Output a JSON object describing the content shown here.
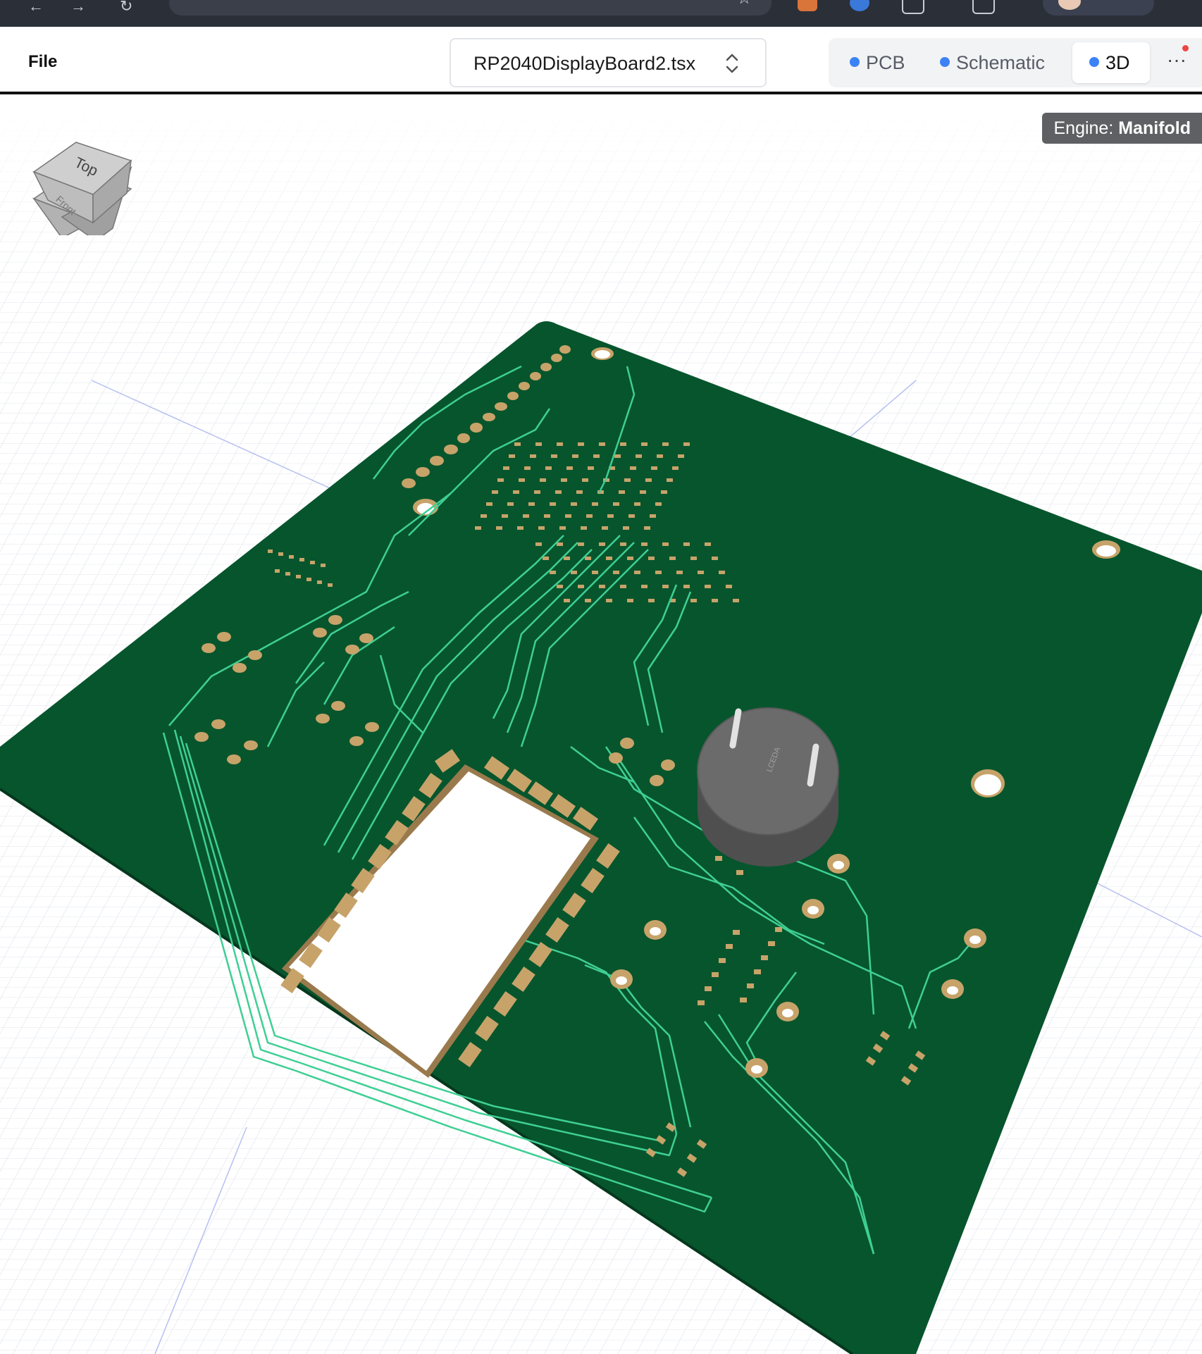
{
  "toolbar": {
    "file_menu": "File",
    "file_name": "RP2040DisplayBoard2.tsx",
    "tabs": [
      {
        "label": "PCB",
        "active": false
      },
      {
        "label": "Schematic",
        "active": false
      },
      {
        "label": "3D",
        "active": true
      }
    ],
    "more_label": "···",
    "tab_dot_color": "#3b82f6",
    "notification_dot_color": "#ef4444"
  },
  "viewer": {
    "engine_label": "Engine:",
    "engine_name": "Manifold",
    "view_cube": {
      "top_label": "Top",
      "front_label": "Front"
    },
    "component_label": "LCEDA",
    "board_color": "#07552d",
    "trace_color": "#3fcf94",
    "pad_color": "#c7a36a",
    "buzzer_color": "#6b6b6b"
  }
}
